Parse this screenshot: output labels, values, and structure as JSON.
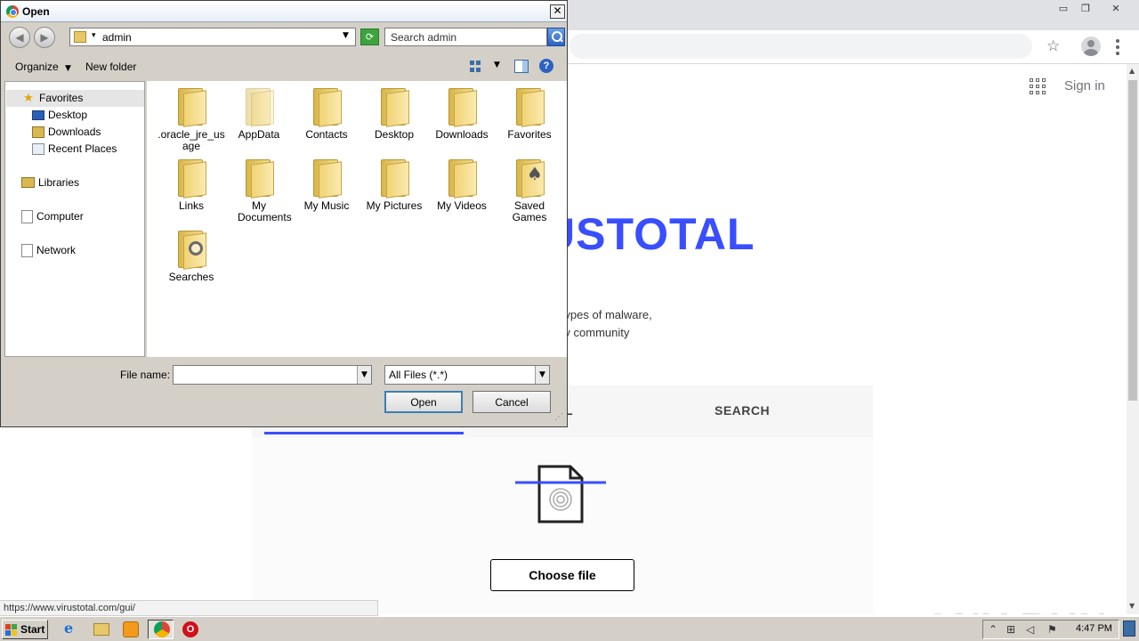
{
  "browser": {
    "window_controls": [
      "▭",
      "❐",
      "✕"
    ],
    "signin_label": "Sign in",
    "logo_text": "USTOTAL",
    "description_lines": [
      "Ls to detect types of malware,",
      "th the security community"
    ],
    "tabs": {
      "file_partial": "L",
      "search": "SEARCH"
    },
    "choose_file_label": "Choose file",
    "status_url": "https://www.virustotal.com/gui/",
    "watermark": "ANY RUN"
  },
  "dialog": {
    "title": "Open",
    "address": "admin",
    "search_placeholder": "Search admin",
    "commands": {
      "organize": "Organize",
      "new_folder": "New folder"
    },
    "nav": {
      "favorites": "Favorites",
      "favorites_items": [
        "Desktop",
        "Downloads",
        "Recent Places"
      ],
      "libraries": "Libraries",
      "computer": "Computer",
      "network": "Network"
    },
    "files": [
      ".oracle_jre_usage",
      "AppData",
      "Contacts",
      "Desktop",
      "Downloads",
      "Favorites",
      "Links",
      "My Documents",
      "My Music",
      "My Pictures",
      "My Videos",
      "Saved Games",
      "Searches"
    ],
    "file_name_label": "File name:",
    "file_name_value": "",
    "filter_value": "All Files (*.*)",
    "open_label": "Open",
    "cancel_label": "Cancel"
  },
  "taskbar": {
    "start_label": "Start",
    "clock": "4:47 PM"
  },
  "colors": {
    "virustotal_blue": "#394eff",
    "dialog_bg": "#d4d0c8"
  }
}
